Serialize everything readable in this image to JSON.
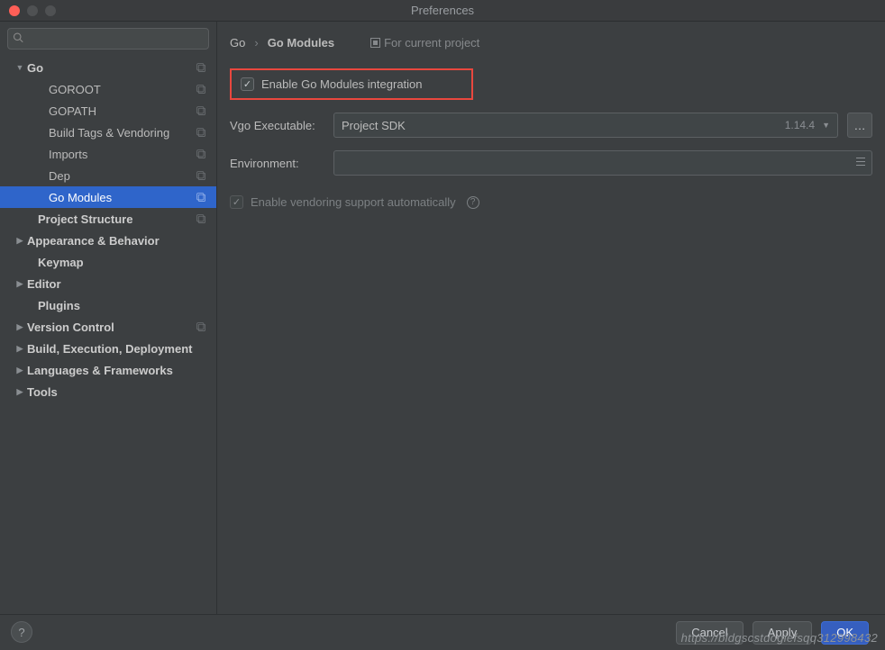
{
  "window": {
    "title": "Preferences"
  },
  "sidebar": {
    "search_placeholder": "",
    "items": [
      {
        "label": "Go",
        "indent": 16,
        "arrow": "▼",
        "bold": true,
        "copy": true
      },
      {
        "label": "GOROOT",
        "indent": 40,
        "copy": true
      },
      {
        "label": "GOPATH",
        "indent": 40,
        "copy": true
      },
      {
        "label": "Build Tags & Vendoring",
        "indent": 40,
        "copy": true
      },
      {
        "label": "Imports",
        "indent": 40,
        "copy": true
      },
      {
        "label": "Dep",
        "indent": 40,
        "copy": true
      },
      {
        "label": "Go Modules",
        "indent": 40,
        "copy": true,
        "selected": true
      },
      {
        "label": "Project Structure",
        "indent": 28,
        "bold": true,
        "copy": true
      },
      {
        "label": "Appearance & Behavior",
        "indent": 16,
        "arrow": "▶",
        "bold": true
      },
      {
        "label": "Keymap",
        "indent": 28,
        "bold": true
      },
      {
        "label": "Editor",
        "indent": 16,
        "arrow": "▶",
        "bold": true
      },
      {
        "label": "Plugins",
        "indent": 28,
        "bold": true
      },
      {
        "label": "Version Control",
        "indent": 16,
        "arrow": "▶",
        "bold": true,
        "copy": true
      },
      {
        "label": "Build, Execution, Deployment",
        "indent": 16,
        "arrow": "▶",
        "bold": true
      },
      {
        "label": "Languages & Frameworks",
        "indent": 16,
        "arrow": "▶",
        "bold": true
      },
      {
        "label": "Tools",
        "indent": 16,
        "arrow": "▶",
        "bold": true
      }
    ]
  },
  "breadcrumb": {
    "root": "Go",
    "leaf": "Go Modules",
    "for_project": "For current project"
  },
  "form": {
    "enable_modules_label": "Enable Go Modules integration",
    "vgo_label": "Vgo Executable:",
    "vgo_value": "Project SDK",
    "vgo_version": "1.14.4",
    "env_label": "Environment:",
    "env_value": "",
    "vendoring_label": "Enable vendoring support automatically"
  },
  "footer": {
    "cancel": "Cancel",
    "apply": "Apply",
    "ok": "OK"
  },
  "watermark": "https://bldgscstdogiefsqq312998432"
}
